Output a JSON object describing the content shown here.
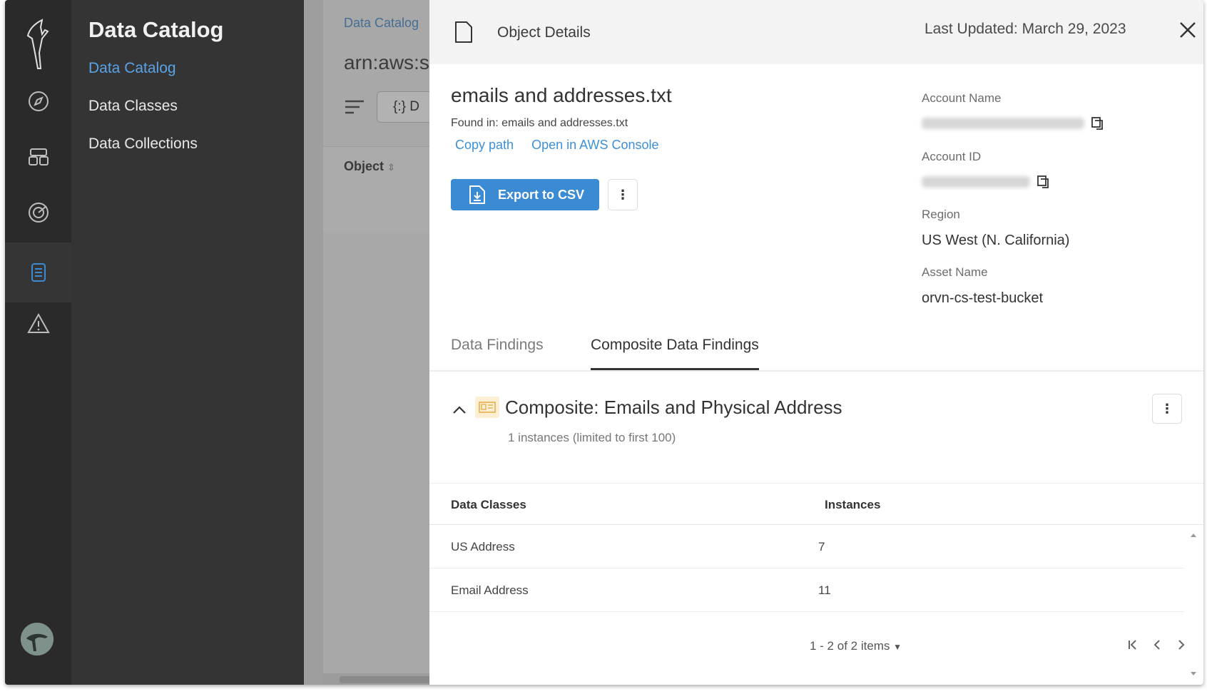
{
  "sidebar": {
    "title": "Data Catalog",
    "items": [
      {
        "label": "Data Catalog",
        "active": true
      },
      {
        "label": "Data Classes",
        "active": false
      },
      {
        "label": "Data Collections",
        "active": false
      }
    ]
  },
  "rail": {
    "icons": [
      "logo-icon",
      "compass-icon",
      "assets-icon",
      "target-icon",
      "database-icon",
      "warning-icon"
    ],
    "active": "database-icon"
  },
  "background": {
    "breadcrumb": "Data Catalog",
    "arn": "arn:aws:s",
    "filter_button_label": "{:} D",
    "column_object": "Object"
  },
  "panel": {
    "header_title": "Object Details",
    "last_updated": "Last Updated: March 29, 2023",
    "file_name": "emails and addresses.txt",
    "found_in": "Found in: emails and addresses.txt",
    "copy_path": "Copy path",
    "open_console": "Open in AWS Console",
    "export_label": "Export to CSV",
    "meta": {
      "account_name_label": "Account Name",
      "account_id_label": "Account ID",
      "region_label": "Region",
      "region_value": "US West (N. California)",
      "asset_name_label": "Asset Name",
      "asset_name_value": "orvn-cs-test-bucket"
    },
    "tabs": [
      {
        "label": "Data Findings",
        "active": false
      },
      {
        "label": "Composite Data Findings",
        "active": true
      }
    ],
    "composite": {
      "title": "Composite: Emails and Physical Address",
      "subtitle": "1 instances (limited to first 100)"
    },
    "table": {
      "headers": [
        "Data Classes",
        "Instances"
      ],
      "rows": [
        {
          "data_class": "US Address",
          "instances": "7"
        },
        {
          "data_class": "Email Address",
          "instances": "11"
        }
      ]
    },
    "pagination": "1 - 2 of 2 items"
  },
  "colors": {
    "accent": "#3b8bd4",
    "rail_bg": "#2a2a2a",
    "sidebar_bg": "#343434",
    "active_link": "#5aa3e6"
  }
}
